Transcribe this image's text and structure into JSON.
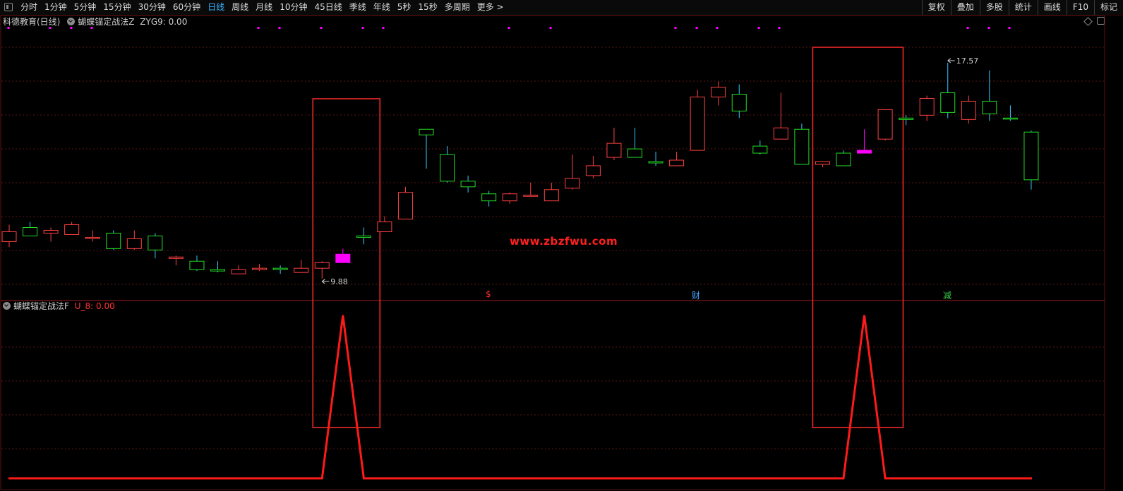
{
  "toolbar": {
    "periods": [
      "分时",
      "1分钟",
      "5分钟",
      "15分钟",
      "30分钟",
      "60分钟",
      "日线",
      "周线",
      "月线",
      "10分钟",
      "45日线",
      "季线",
      "年线",
      "5秒",
      "15秒",
      "多周期",
      "更多 >"
    ],
    "active_period": "日线",
    "right_buttons": [
      "复权",
      "叠加",
      "多股",
      "统计",
      "画线",
      "F10",
      "标记"
    ]
  },
  "main_panel": {
    "stock_name": "科德教育(日线)",
    "indicator_name": "蝴蝶锚定战法Z",
    "indicator_value": "ZYG9: 0.00",
    "watermark": "www.zbzfwu.com",
    "low_label": "9.88",
    "high_label": "17.57",
    "signals": [
      "$",
      "财",
      "减"
    ],
    "signal_colors": [
      "#ff3030",
      "#4aa8ff",
      "#39d24a"
    ]
  },
  "sub_panel": {
    "indicator_name": "蝴蝶锚定战法F",
    "indicator_value": "U_8: 0.00"
  },
  "colors": {
    "up": "#ff4040",
    "down": "#22dd22",
    "highlight": "#ff00ff",
    "box": "#ff2a2a",
    "grid": "#5a1414",
    "wick_down": "#38c8ff"
  },
  "chart_data": [
    {
      "type": "candlestick",
      "title": "",
      "y_range": [
        9.3,
        18.8
      ],
      "low_marked": 9.88,
      "high_marked": 17.57,
      "candles": [
        {
          "o": 11.2,
          "h": 11.8,
          "l": 11.0,
          "c": 11.55,
          "d": "up"
        },
        {
          "o": 11.7,
          "h": 11.9,
          "l": 11.4,
          "c": 11.4,
          "d": "down"
        },
        {
          "o": 11.5,
          "h": 11.7,
          "l": 11.2,
          "c": 11.6,
          "d": "up"
        },
        {
          "o": 11.45,
          "h": 11.9,
          "l": 11.45,
          "c": 11.8,
          "d": "up"
        },
        {
          "o": 11.3,
          "h": 11.6,
          "l": 11.2,
          "c": 11.35,
          "d": "up"
        },
        {
          "o": 11.5,
          "h": 11.6,
          "l": 10.9,
          "c": 10.95,
          "d": "down"
        },
        {
          "o": 10.95,
          "h": 11.6,
          "l": 10.9,
          "c": 11.3,
          "d": "up"
        },
        {
          "o": 11.4,
          "h": 11.5,
          "l": 10.6,
          "c": 10.9,
          "d": "down"
        },
        {
          "o": 10.6,
          "h": 10.7,
          "l": 10.35,
          "c": 10.65,
          "d": "up"
        },
        {
          "o": 10.5,
          "h": 10.7,
          "l": 10.15,
          "c": 10.2,
          "d": "down"
        },
        {
          "o": 10.2,
          "h": 10.5,
          "l": 10.1,
          "c": 10.15,
          "d": "down"
        },
        {
          "o": 10.05,
          "h": 10.35,
          "l": 10.05,
          "c": 10.2,
          "d": "up"
        },
        {
          "o": 10.2,
          "h": 10.4,
          "l": 10.15,
          "c": 10.25,
          "d": "up"
        },
        {
          "o": 10.25,
          "h": 10.35,
          "l": 10.05,
          "c": 10.2,
          "d": "down"
        },
        {
          "o": 10.1,
          "h": 10.55,
          "l": 10.1,
          "c": 10.25,
          "d": "up"
        },
        {
          "o": 10.25,
          "h": 10.5,
          "l": 9.88,
          "c": 10.45,
          "d": "up"
        },
        {
          "o": 10.45,
          "h": 10.95,
          "l": 10.45,
          "c": 10.75,
          "d": "up",
          "hl": true
        },
        {
          "o": 11.4,
          "h": 11.7,
          "l": 11.1,
          "c": 11.35,
          "d": "down"
        },
        {
          "o": 11.55,
          "h": 12.1,
          "l": 11.55,
          "c": 11.9,
          "d": "up"
        },
        {
          "o": 12.0,
          "h": 13.15,
          "l": 12.0,
          "c": 12.95,
          "d": "up"
        },
        {
          "o": 15.0,
          "h": 15.0,
          "l": 13.8,
          "c": 15.2,
          "d": "down"
        },
        {
          "o": 14.3,
          "h": 14.6,
          "l": 13.3,
          "c": 13.35,
          "d": "down"
        },
        {
          "o": 13.35,
          "h": 13.55,
          "l": 12.95,
          "c": 13.15,
          "d": "down"
        },
        {
          "o": 12.9,
          "h": 13.0,
          "l": 12.45,
          "c": 12.65,
          "d": "down"
        },
        {
          "o": 12.65,
          "h": 12.95,
          "l": 12.55,
          "c": 12.9,
          "d": "up"
        },
        {
          "o": 12.85,
          "h": 13.3,
          "l": 12.8,
          "c": 12.85,
          "d": "up"
        },
        {
          "o": 12.65,
          "h": 13.3,
          "l": 12.65,
          "c": 13.05,
          "d": "up"
        },
        {
          "o": 13.1,
          "h": 14.3,
          "l": 13.05,
          "c": 13.45,
          "d": "up"
        },
        {
          "o": 13.55,
          "h": 14.25,
          "l": 13.45,
          "c": 13.9,
          "d": "up"
        },
        {
          "o": 14.2,
          "h": 15.25,
          "l": 14.1,
          "c": 14.7,
          "d": "up"
        },
        {
          "o": 14.5,
          "h": 15.25,
          "l": 14.3,
          "c": 14.2,
          "d": "down"
        },
        {
          "o": 14.05,
          "h": 14.4,
          "l": 13.9,
          "c": 14.0,
          "d": "down"
        },
        {
          "o": 13.9,
          "h": 14.4,
          "l": 13.9,
          "c": 14.1,
          "d": "up"
        },
        {
          "o": 14.45,
          "h": 16.6,
          "l": 14.45,
          "c": 16.35,
          "d": "up"
        },
        {
          "o": 16.35,
          "h": 16.9,
          "l": 16.05,
          "c": 16.7,
          "d": "up"
        },
        {
          "o": 16.45,
          "h": 16.8,
          "l": 15.6,
          "c": 15.85,
          "d": "down"
        },
        {
          "o": 14.6,
          "h": 14.8,
          "l": 14.3,
          "c": 14.35,
          "d": "down"
        },
        {
          "o": 14.85,
          "h": 16.5,
          "l": 14.85,
          "c": 15.25,
          "d": "up"
        },
        {
          "o": 15.2,
          "h": 15.4,
          "l": 13.95,
          "c": 13.95,
          "d": "down"
        },
        {
          "o": 13.95,
          "h": 14.0,
          "l": 13.85,
          "c": 14.05,
          "d": "up"
        },
        {
          "o": 14.35,
          "h": 14.45,
          "l": 13.95,
          "c": 13.9,
          "d": "down"
        },
        {
          "o": 14.35,
          "h": 15.2,
          "l": 14.35,
          "c": 14.45,
          "d": "up",
          "hl": true
        },
        {
          "o": 14.85,
          "h": 15.8,
          "l": 14.8,
          "c": 15.9,
          "d": "up"
        },
        {
          "o": 15.55,
          "h": 15.7,
          "l": 15.35,
          "c": 15.6,
          "d": "down"
        },
        {
          "o": 15.7,
          "h": 16.4,
          "l": 15.5,
          "c": 16.3,
          "d": "up"
        },
        {
          "o": 16.5,
          "h": 17.57,
          "l": 15.6,
          "c": 15.8,
          "d": "down"
        },
        {
          "o": 15.55,
          "h": 16.4,
          "l": 15.4,
          "c": 16.2,
          "d": "up"
        },
        {
          "o": 16.2,
          "h": 17.3,
          "l": 15.5,
          "c": 15.75,
          "d": "down"
        },
        {
          "o": 15.6,
          "h": 16.05,
          "l": 15.5,
          "c": 15.6,
          "d": "down"
        },
        {
          "o": 15.1,
          "h": 15.15,
          "l": 13.05,
          "c": 13.4,
          "d": "down"
        }
      ]
    },
    {
      "type": "line",
      "title": "",
      "series": [
        {
          "name": "U_8",
          "values": [
            0,
            0,
            0,
            0,
            0,
            0,
            0,
            0,
            0,
            0,
            0,
            0,
            0,
            0,
            0,
            0,
            1,
            0,
            0,
            0,
            0,
            0,
            0,
            0,
            0,
            0,
            0,
            0,
            0,
            0,
            0,
            0,
            0,
            0,
            0,
            0,
            0,
            0,
            0,
            0,
            0,
            1,
            0,
            0,
            0,
            0,
            0,
            0,
            0,
            0
          ]
        }
      ],
      "y_range": [
        0,
        1
      ]
    }
  ]
}
